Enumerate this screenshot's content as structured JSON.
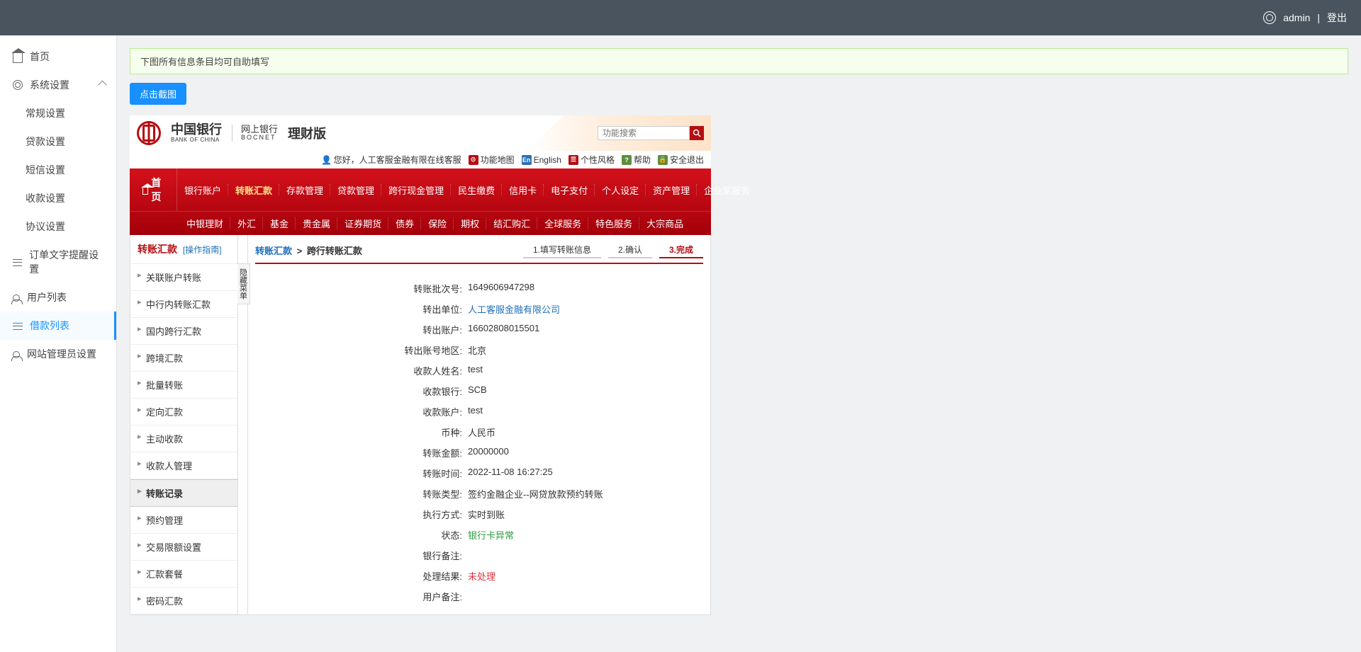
{
  "header": {
    "user": "admin",
    "logout": "登出"
  },
  "sidebar": {
    "home": "首页",
    "sys_settings": "系统设置",
    "sub": {
      "general": "常规设置",
      "loan": "贷款设置",
      "sms": "短信设置",
      "receipt": "收款设置",
      "agreement": "协议设置"
    },
    "order_text": "订单文字提醒设置",
    "user_list": "用户列表",
    "loan_list": "借款列表",
    "admin": "网站管理员设置"
  },
  "banner": "下图所有信息条目均可自助填写",
  "screenshot_btn": "点击截图",
  "bank": {
    "brand_cn": "中国银行",
    "brand_en": "BANK OF CHINA",
    "sub_cn": "网上银行",
    "sub_en": "BOCNET",
    "version": "理财版",
    "search_placeholder": "功能搜索",
    "util": {
      "hello": "您好，人工客服金融有限在线客服",
      "map": "功能地图",
      "english": "English",
      "style": "个性风格",
      "help": "帮助",
      "logout": "安全退出"
    },
    "nav_home": "首页",
    "nav1": [
      "银行账户",
      "转账汇款",
      "存款管理",
      "贷款管理",
      "跨行现金管理",
      "民生缴费",
      "信用卡",
      "电子支付",
      "个人设定",
      "资产管理",
      "企业家服务"
    ],
    "nav1_active_index": 1,
    "nav2": [
      "中银理财",
      "外汇",
      "基金",
      "贵金属",
      "证券期货",
      "债券",
      "保险",
      "期权",
      "结汇购汇",
      "全球服务",
      "特色服务",
      "大宗商品"
    ],
    "side_title": "转账汇款",
    "side_guide": "[操作指南]",
    "side_items": [
      "关联账户转账",
      "中行内转账汇款",
      "国内跨行汇款",
      "跨境汇款",
      "批量转账",
      "定向汇款",
      "主动收款",
      "收款人管理",
      "转账记录",
      "预约管理",
      "交易限额设置",
      "汇款套餐",
      "密码汇款"
    ],
    "side_selected_index": 8,
    "hide_label": "隐藏菜单",
    "crumb1": "转账汇款",
    "crumb2": "跨行转账汇款",
    "steps": [
      "1.填写转账信息",
      "2.确认",
      "3.完成"
    ],
    "details": [
      {
        "label": "转账批次号:",
        "value": "1649606947298"
      },
      {
        "label": "转出单位:",
        "value": "人工客服金融有限公司",
        "cls": "val-blue"
      },
      {
        "label": "转出账户:",
        "value": "16602808015501"
      },
      {
        "label": "转出账号地区:",
        "value": "北京"
      },
      {
        "label": "收款人姓名:",
        "value": "test"
      },
      {
        "label": "收款银行:",
        "value": "SCB"
      },
      {
        "label": "收款账户:",
        "value": "test"
      },
      {
        "label": "币种:",
        "value": "人民币"
      },
      {
        "label": "转账金额:",
        "value": "20000000"
      },
      {
        "label": "转账时间:",
        "value": "2022-11-08 16:27:25"
      },
      {
        "label": "转账类型:",
        "value": "签约金融企业--网贷放款预约转账"
      },
      {
        "label": "执行方式:",
        "value": "实时到账"
      },
      {
        "label": "状态:",
        "value": "银行卡异常",
        "cls": "val-green"
      },
      {
        "label": "银行备注:",
        "value": ""
      },
      {
        "label": "处理结果:",
        "value": "未处理",
        "cls": "val-red"
      },
      {
        "label": "用户备注:",
        "value": ""
      }
    ]
  }
}
